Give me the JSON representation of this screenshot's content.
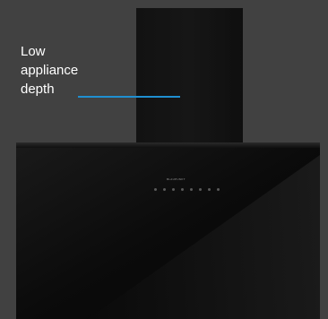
{
  "annotation": {
    "lines": [
      "Low",
      "appliance",
      "depth"
    ],
    "line_color": "#1f8fd0"
  },
  "product": {
    "brand": "BLAUPUNKT",
    "control_count": 8
  }
}
